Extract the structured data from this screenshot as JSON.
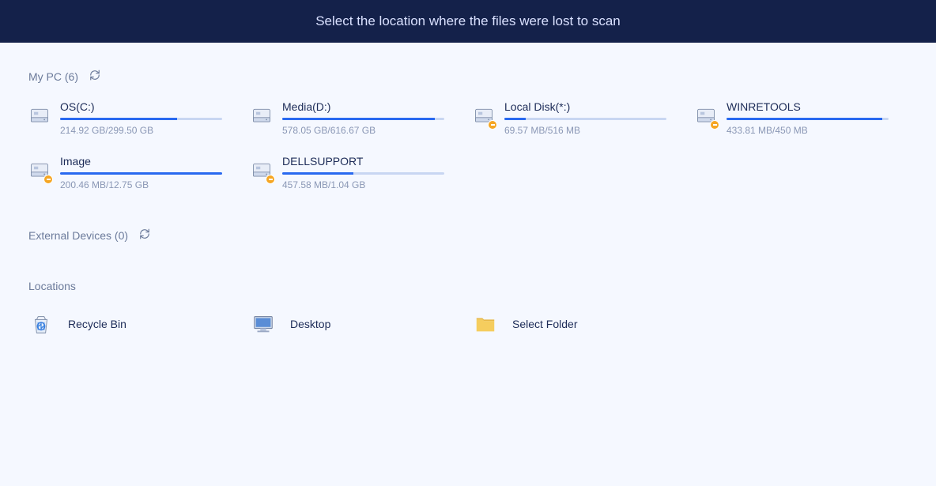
{
  "header": {
    "title": "Select the location where the files were lost to scan"
  },
  "mypc": {
    "label": "My PC (6)",
    "drives": [
      {
        "name": "OS(C:)",
        "usage": "214.92 GB/299.50 GB",
        "fill": 72,
        "badge": false
      },
      {
        "name": "Media(D:)",
        "usage": "578.05 GB/616.67 GB",
        "fill": 94,
        "badge": false
      },
      {
        "name": "Local Disk(*:)",
        "usage": "69.57 MB/516 MB",
        "fill": 13,
        "badge": true
      },
      {
        "name": "WINRETOOLS",
        "usage": "433.81 MB/450 MB",
        "fill": 96,
        "badge": true
      },
      {
        "name": "Image",
        "usage": "200.46 MB/12.75 GB",
        "fill": 100,
        "badge": true
      },
      {
        "name": "DELLSUPPORT",
        "usage": "457.58 MB/1.04 GB",
        "fill": 44,
        "badge": true
      }
    ]
  },
  "external": {
    "label": "External Devices (0)"
  },
  "locations": {
    "label": "Locations",
    "items": [
      {
        "name": "Recycle Bin",
        "icon": "recycle-bin-icon"
      },
      {
        "name": "Desktop",
        "icon": "desktop-icon"
      },
      {
        "name": "Select Folder",
        "icon": "folder-icon"
      }
    ]
  },
  "icons": {
    "refresh": "⟳"
  }
}
